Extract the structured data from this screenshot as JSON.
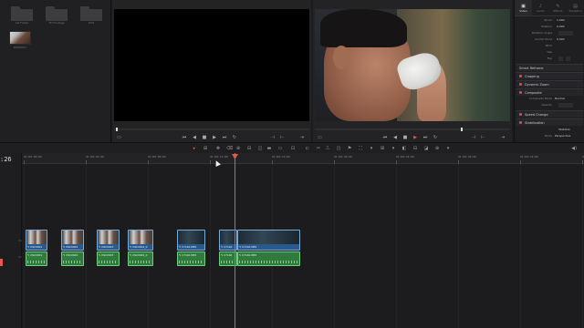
{
  "media_pool": {
    "bins": [
      "1st Folder",
      "3D Footage",
      "Edit"
    ],
    "clips": [
      {
        "name": "DSC0001"
      }
    ]
  },
  "source_viewer": {
    "transport": [
      "⏮",
      "◀",
      "■",
      "▶",
      "⏭",
      "↻"
    ]
  },
  "timeline_viewer": {
    "transport": [
      "⏮",
      "◀",
      "■",
      "▶",
      "⏭",
      "↻"
    ]
  },
  "inspector": {
    "tabs": [
      {
        "label": "Video",
        "icon": "▣"
      },
      {
        "label": "Audio",
        "icon": "♪"
      },
      {
        "label": "Effects",
        "icon": "✎"
      },
      {
        "label": "Transition",
        "icon": "▤"
      }
    ],
    "active_tab": "Video",
    "properties": [
      {
        "key": "Zoom",
        "value": "1.000"
      },
      {
        "key": "Position",
        "value": "0.000"
      },
      {
        "key": "Rotation Angle",
        "value": ""
      },
      {
        "key": "Anchor Point",
        "value": "0.000"
      },
      {
        "key": "Pitch",
        "value": ""
      },
      {
        "key": "Yaw",
        "value": ""
      },
      {
        "key": "Flip",
        "value": ""
      }
    ],
    "sections": [
      {
        "label": "Smart Reframe",
        "dot": false
      },
      {
        "label": "Cropping",
        "dot": true
      },
      {
        "label": "Dynamic Zoom",
        "dot": true
      },
      {
        "label": "Composite",
        "dot": true
      },
      {
        "label": "Speed Change",
        "dot": true
      },
      {
        "label": "Stabilization",
        "dot": true
      }
    ],
    "composite": [
      {
        "key": "Composite Mode",
        "value": "Normal"
      },
      {
        "key": "Opacity",
        "value": ""
      }
    ],
    "stabilization": [
      {
        "key": "",
        "value": "Stabilize"
      },
      {
        "key": "Mode",
        "value": "Perspective"
      }
    ]
  },
  "toolbar": {
    "tools": [
      "▸",
      "⊞",
      "✥",
      "⌫",
      "⊕",
      "⊟",
      "◫",
      "▬",
      "▭",
      "⊡",
      "⊏",
      "✂",
      "⎍",
      "◳",
      "⚑",
      "⛶",
      "▾",
      "⊞",
      "▾",
      "◧",
      "⊟",
      "◪",
      "⊕",
      "▾"
    ]
  },
  "timeline": {
    "timecode": ":26",
    "ruler_labels": [
      "01:00:00:00",
      "01:00:04:00",
      "01:00:08:00",
      "01:00:12:00",
      "01:00:16:00",
      "01:00:20:00",
      "01:00:24:00",
      "01:00:28:00",
      "01:00:32:00",
      "01:00:36:00"
    ],
    "video_clips": [
      "DSC0001",
      "DSC0002",
      "DSC0003",
      "DSC0004_0",
      "C7140.MP4",
      "C7140",
      "C7140.MP4"
    ],
    "audio_clips": [
      "DSC0001",
      "DSC0002",
      "DSC0003",
      "DSC0004_0",
      "C7140.MP4",
      "C7140",
      "C7140.MP4"
    ]
  },
  "colors": {
    "accent": "#e05a4a",
    "video_clip": "#2a5a8c",
    "audio_clip": "#2f7a3c"
  }
}
